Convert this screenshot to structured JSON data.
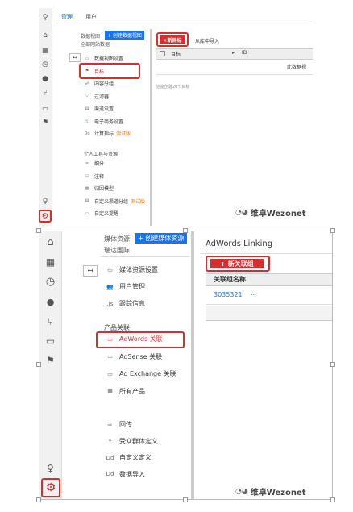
{
  "top": {
    "tabs": [
      "管理",
      "用户"
    ],
    "view_label": "数据视图",
    "create_view": "+ 创建数据视图",
    "all_data": "全部网站数据",
    "menu": [
      {
        "icon": "▭",
        "label": "数据视图设置"
      },
      {
        "icon": "⚑",
        "label": "目标"
      },
      {
        "icon": "☍",
        "label": "内容分组"
      },
      {
        "icon": "▽",
        "label": "过滤器"
      },
      {
        "icon": "▤",
        "label": "渠道设置"
      },
      {
        "icon": "🛒",
        "label": "电子商务设置"
      },
      {
        "icon": "Dd",
        "label": "计算指标",
        "tag": "测试版"
      }
    ],
    "section": "个人工具与资源",
    "menu2": [
      {
        "icon": "≋",
        "label": "细分"
      },
      {
        "icon": "▭",
        "label": "注释"
      },
      {
        "icon": "▦",
        "label": "归因模型"
      },
      {
        "icon": "▤",
        "label": "自定义渠道分组",
        "tag": "测试版"
      },
      {
        "icon": "▭",
        "label": "自定义提醒"
      }
    ],
    "new_goal": "+新目标",
    "import": "从库中导入",
    "col_goal": "目标",
    "col_id": "ID",
    "empty": "此数据视",
    "footer": "还能创建20个目标"
  },
  "bottom": {
    "property_label": "媒体资源",
    "create_property": "+ 创建媒体资源",
    "account": "瑞达国际",
    "menu": [
      {
        "icon": "▭",
        "label": "媒体资源设置"
      },
      {
        "icon": "👥",
        "label": "用户管理"
      },
      {
        "icon": ".js",
        "label": "跟踪信息"
      }
    ],
    "section": "产品关联",
    "menu2": [
      {
        "icon": "▭",
        "label": "AdWords 关联"
      },
      {
        "icon": "▭",
        "label": "AdSense 关联"
      },
      {
        "icon": "▭",
        "label": "Ad Exchange 关联"
      },
      {
        "icon": "▦",
        "label": "所有产品"
      }
    ],
    "menu3": [
      {
        "icon": "⇨",
        "label": "回传"
      },
      {
        "icon": "⑂",
        "label": "受众群体定义"
      },
      {
        "icon": "Dd",
        "label": "自定义定义"
      },
      {
        "icon": "Dd",
        "label": "数据导入"
      }
    ],
    "panel_title": "AdWords Linking",
    "new_link": "+ 新关联组",
    "col_name": "关联组名称",
    "row_id": "3035321",
    "row_dots": ".."
  },
  "watermark": "维卓Wezonet",
  "colors": {
    "accent_red": "#d32f2f",
    "blue": "#1a73e8",
    "orange": "#e8710a"
  }
}
